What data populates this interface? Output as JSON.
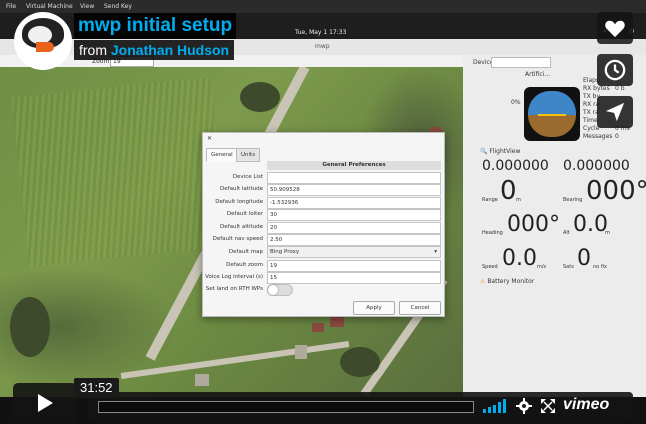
{
  "video": {
    "title": "mwp initial setup",
    "from_label": "from",
    "author": "Jonathan Hudson",
    "timecode": "31:52",
    "brand": "vimeo",
    "accent_color": "#00adef",
    "side_buttons": [
      {
        "icon": "heart-icon"
      },
      {
        "icon": "clock-icon"
      },
      {
        "icon": "send-icon"
      }
    ]
  },
  "vm": {
    "menu": [
      "File",
      "Virtual Machine",
      "View",
      "Send Key"
    ],
    "clock": "Tue, May 1  17:33",
    "window_title": "mwp",
    "toolbar": {
      "zoom_label": "Zoom",
      "zoom_value": "19"
    }
  },
  "right_panel": {
    "device_label": "Device",
    "artificial_horizon_label": "Artifici...",
    "telemetry_labels": [
      "Elaps",
      "RX bytes",
      "TX by",
      "RX ra",
      "TX ra",
      "Time",
      "Cycle",
      "Messages"
    ],
    "telemetry_values": [
      "",
      "0 b",
      "",
      "",
      "",
      "",
      "0 ms",
      "0"
    ],
    "small_values": [
      "0%"
    ],
    "flightview": {
      "label": "FlightView",
      "lat": "0.000000",
      "lon": "0.000000",
      "range_label": "Range",
      "range_value": "0",
      "range_unit": "m",
      "bearing_label": "Bearing",
      "bearing_value": "000°",
      "heading_label": "Heading",
      "heading_value": "000°",
      "alt_label": "Alt",
      "alt_value": "0.0",
      "alt_unit": "m",
      "speed_label": "Speed",
      "speed_value": "0.0",
      "speed_unit": "m/s",
      "sats_label": "Sats",
      "sats_value": "0",
      "sats_unit": "no fix"
    },
    "battery_label": "Battery Monitor"
  },
  "dialog": {
    "tabs": [
      "General",
      "Units"
    ],
    "section_title": "General Preferences",
    "rows": [
      {
        "label": "Device List",
        "value": ""
      },
      {
        "label": "Default latitude",
        "value": "50.909528"
      },
      {
        "label": "Default longitude",
        "value": "-1.532936"
      },
      {
        "label": "Default loiter",
        "value": "30"
      },
      {
        "label": "Default altitude",
        "value": "20"
      },
      {
        "label": "Default nav speed",
        "value": "2.50"
      },
      {
        "label": "Default map",
        "value": "Bing Proxy"
      },
      {
        "label": "Default zoom",
        "value": "19"
      },
      {
        "label": "Voice Log interval (s)",
        "value": "15"
      },
      {
        "label": "Set land on RTH WPs",
        "value": ""
      }
    ],
    "default_map_is_dropdown": true,
    "land_on_rth_enabled": false,
    "apply_label": "Apply",
    "cancel_label": "Cancel"
  }
}
